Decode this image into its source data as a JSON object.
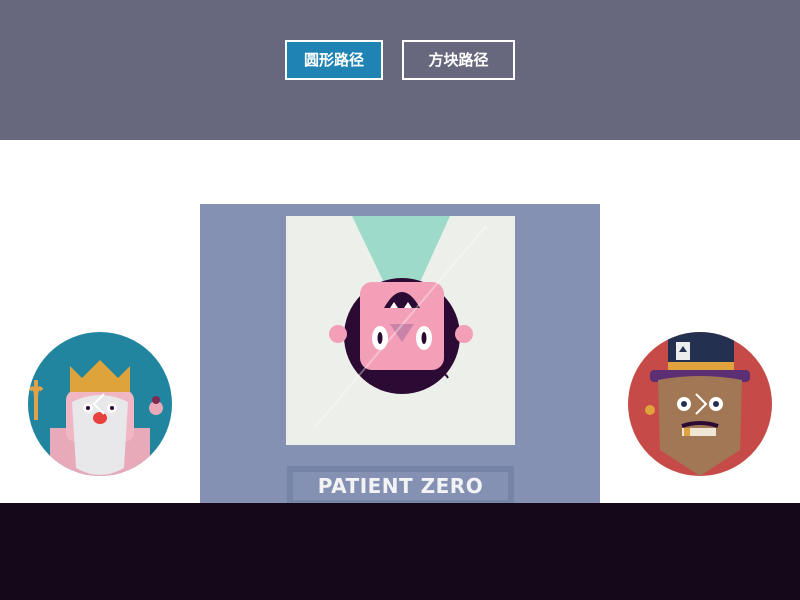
{
  "tabs": {
    "circle_label": "圆形路径",
    "square_label": "方块路径"
  },
  "carousel": {
    "current": {
      "title": "PATIENT ZERO",
      "artwork": "patient-zero-character"
    },
    "previous": {
      "artwork": "neptune-king-character"
    },
    "next": {
      "artwork": "card-hat-character"
    },
    "prev_icon": "chevron-left-icon",
    "next_icon": "chevron-right-icon"
  },
  "colors": {
    "header_bg": "#67687d",
    "active_tab": "#1f83b4",
    "card_bg": "#8491b3",
    "footer_bg": "#15081a"
  }
}
